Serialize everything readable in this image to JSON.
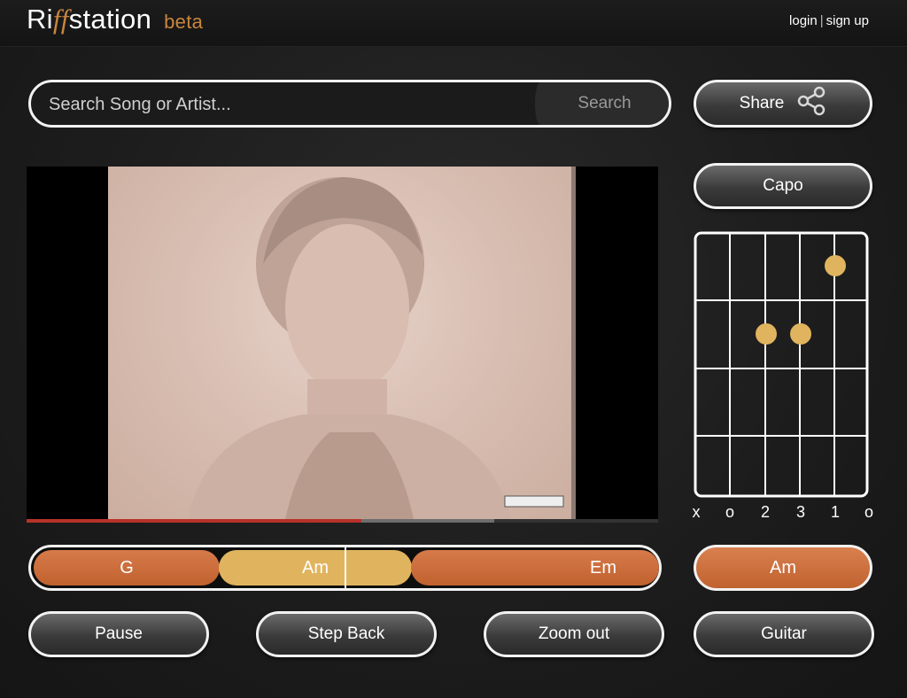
{
  "header": {
    "logo_pre": "Ri",
    "logo_ff": "ff",
    "logo_post": "station",
    "logo_beta": "beta",
    "login": "login",
    "separator": "|",
    "signup": "sign up"
  },
  "search": {
    "placeholder": "Search Song or Artist...",
    "button": "Search"
  },
  "share": {
    "label": "Share",
    "icon": "share-icon"
  },
  "capo": {
    "label": "Capo"
  },
  "video": {
    "progress_played": 0.53,
    "progress_buffered_start": 0.53,
    "progress_buffered_end": 0.74
  },
  "chords": [
    {
      "name": "G",
      "color": "#c8683a"
    },
    {
      "name": "Am",
      "color": "#e0b45e"
    },
    {
      "name": "Em",
      "color": "#c8683a"
    }
  ],
  "chord_diagram": {
    "chord": "Am",
    "string_labels": [
      "x",
      "o",
      "2",
      "3",
      "1",
      "o"
    ],
    "dot_color": "#e0b45e"
  },
  "current_chord": "Am",
  "controls": {
    "pause": "Pause",
    "step_back": "Step Back",
    "zoom_out": "Zoom out",
    "instrument": "Guitar"
  },
  "colors": {
    "accent": "#c8863e",
    "chord_copper": "#c8683a",
    "chord_gold": "#e0b45e"
  }
}
